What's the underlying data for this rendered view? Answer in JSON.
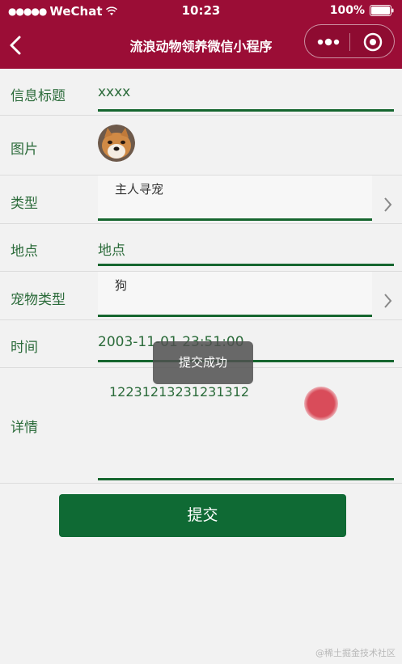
{
  "status_bar": {
    "signal": "●●●●●",
    "carrier": "WeChat",
    "time": "10:23",
    "battery": "100%"
  },
  "nav": {
    "title": "流浪动物领养微信小程序",
    "header_color": "#9b0d36"
  },
  "form": {
    "title_row": {
      "label": "信息标题",
      "value": "xxxx"
    },
    "image_row": {
      "label": "图片"
    },
    "type_row": {
      "label": "类型",
      "value": "主人寻宠"
    },
    "location_row": {
      "label": "地点",
      "value": "地点"
    },
    "pet_type_row": {
      "label": "宠物类型",
      "value": "狗"
    },
    "time_row": {
      "label": "时间",
      "value": "2003-11-01 23:51:00"
    },
    "detail_row": {
      "label": "详情",
      "value": "12231213231231312"
    }
  },
  "submit_label": "提交",
  "toast": {
    "message": "提交成功"
  },
  "watermark": "@稀土掘金技术社区",
  "accent_color": "#0f6a34"
}
